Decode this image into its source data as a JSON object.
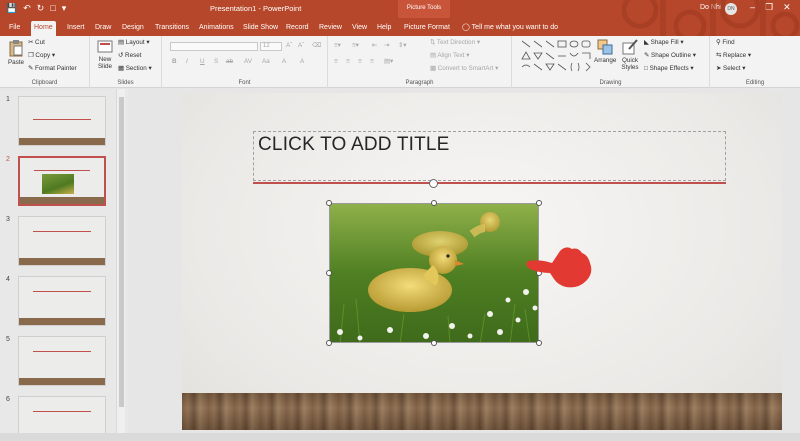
{
  "window": {
    "title": "Presentation1 - PowerPoint",
    "context_tools": "Picture Tools",
    "user_name": "Do Nhi",
    "user_initials": "DN"
  },
  "tabs": [
    {
      "label": "File"
    },
    {
      "label": "Home",
      "active": true
    },
    {
      "label": "Insert"
    },
    {
      "label": "Draw"
    },
    {
      "label": "Design"
    },
    {
      "label": "Transitions"
    },
    {
      "label": "Animations"
    },
    {
      "label": "Slide Show"
    },
    {
      "label": "Record"
    },
    {
      "label": "Review"
    },
    {
      "label": "View"
    },
    {
      "label": "Help"
    },
    {
      "label": "Picture Format"
    }
  ],
  "tell_me": "Tell me what you want to do",
  "ribbon": {
    "clipboard": {
      "paste": "Paste",
      "cut": "Cut",
      "copy": "Copy",
      "format_painter": "Format Painter",
      "label": "Clipboard"
    },
    "slides": {
      "new_slide_line1": "New",
      "new_slide_line2": "Slide",
      "layout": "Layout",
      "reset": "Reset",
      "section": "Section",
      "label": "Slides"
    },
    "font": {
      "label": "Font",
      "size": "12",
      "buttons": [
        "B",
        "I",
        "U",
        "S",
        "ab",
        "AV",
        "Aa",
        "A",
        "A"
      ]
    },
    "paragraph": {
      "label": "Paragraph",
      "text_direction": "Text Direction",
      "align_text": "Align Text",
      "convert_smartart": "Convert to SmartArt"
    },
    "drawing": {
      "label": "Drawing",
      "arrange": "Arrange",
      "quick_styles_line1": "Quick",
      "quick_styles_line2": "Styles",
      "shape_fill": "Shape Fill",
      "shape_outline": "Shape Outline",
      "shape_effects": "Shape Effects"
    },
    "editing": {
      "label": "Editing",
      "find": "Find",
      "replace": "Replace",
      "select": "Select"
    }
  },
  "thumbnails": [
    {
      "number": "1",
      "has_picture": false,
      "selected": false
    },
    {
      "number": "2",
      "has_picture": true,
      "selected": true
    },
    {
      "number": "3",
      "has_picture": false,
      "selected": false
    },
    {
      "number": "4",
      "has_picture": false,
      "selected": false
    },
    {
      "number": "5",
      "has_picture": false,
      "selected": false
    },
    {
      "number": "6",
      "has_picture": false,
      "selected": false
    }
  ],
  "slide": {
    "title_placeholder": "CLICK TO ADD TITLE"
  },
  "colors": {
    "accent": "#b7472a",
    "title_line": "#c0504d"
  }
}
